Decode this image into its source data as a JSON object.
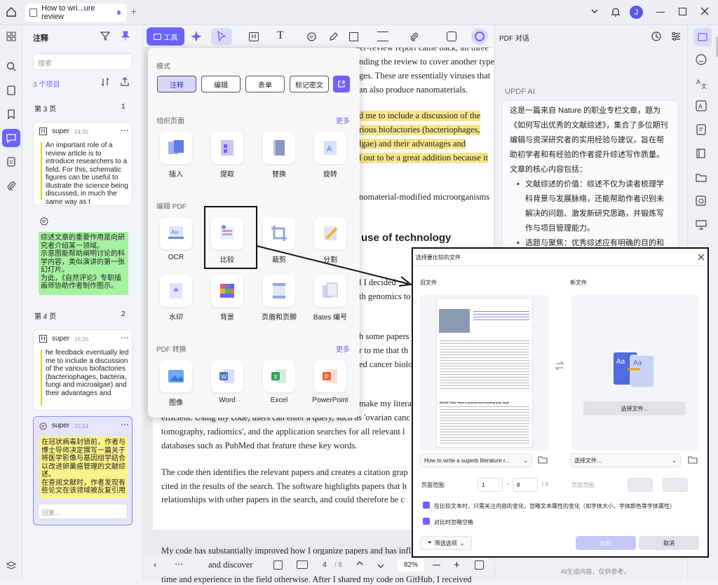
{
  "tab": {
    "title": "How to wri...ure review",
    "add": "+"
  },
  "window": {
    "avatar_initial": "J"
  },
  "comments_panel": {
    "title": "注释",
    "search_placeholder": "搜索",
    "count": "3 个项目",
    "page3": "第 3 页",
    "page3_count": "1",
    "page4": "第 4 页",
    "page4_count": "2",
    "cards": [
      {
        "user": "super",
        "time": "14:35",
        "text": "An important role of a review article is to introduce researchers to a field. For this, schematic figures can be useful to illustrate the science being discussed, in much the same way as t"
      },
      {
        "text": "综述文章的重要作用是向研究者介绍某一领域。\n示意图能帮助阐明讨论的科学内容，类似演讲的第一张幻灯片。\n为此，《自然评论》专职插画师协助作者制作图示。"
      },
      {
        "user": "super",
        "time": "15:20",
        "text": "he feedback eventually led me to include a discussion of the various biofactories (bacteriophages, bacteria, fungi and microalgae) and their advantages and"
      },
      {
        "user": "super",
        "time": "15:24",
        "text": "在冠状病毒封锁前，作者与博士导师决定撰写一篇关于将医学影像与基因组学结合以改进卵巢癌管理的文献综述。\n在查阅文献时，作者发现有些论文在该领域被反复引用"
      }
    ],
    "reply_placeholder": "回复..."
  },
  "toolbar": {
    "tools_label": "工具",
    "zoom": "82%",
    "page_current": "4",
    "page_total": "/ 8"
  },
  "tools_menu": {
    "mode_title": "模式",
    "modes": [
      "注释",
      "编辑",
      "表单",
      "标记密文"
    ],
    "organize_title": "组织页面",
    "more": "更多",
    "organize": [
      "插入",
      "提取",
      "替换",
      "旋转"
    ],
    "edit_title": "编辑 PDF",
    "edit": [
      "OCR",
      "比较",
      "裁剪",
      "分割",
      "水印",
      "背景",
      "页眉和页脚",
      "Bates 编号"
    ],
    "convert_title": "PDF 转换",
    "convert": [
      "图像",
      "Word",
      "Excel",
      "PowerPoint"
    ]
  },
  "document": {
    "lines": [
      "However, when the first peer-review report came back, all three",
      "nding the review to cover another type",
      "ges. These are essentially viruses that",
      "an also produce nanomaterials.",
      "d me to include a discussion of the",
      "rious biofactories (bacteriophages,",
      "lgae) and their advantages and",
      "l out to be a great addition because it",
      "nomaterial-modified microorganisms",
      "use of technology",
      "l I decided",
      "th genomics to",
      "h some papers",
      "r to me that th",
      "ed cancer biolo",
      "make my literat",
      "efficient. Using my code, users can enter a query, such as 'ovarian canc",
      "tomography, radiomics', and the application searches for all relevant l",
      "databases such as PubMed that feature these key words.",
      "The code then identifies the relevant papers and creates a citation grap",
      "cited in the results of the search. The software highlights papers that h",
      "relationships with other papers in the search, and could therefore be c",
      "My code has substantially improved how I organize papers and has infl",
      "and discover",
      "time and experience in the field otherwise. After I shared my code on GitHub, I received"
    ]
  },
  "chat_panel": {
    "title": "PDF 对话",
    "ai_label": "UPDF AI",
    "intro": "这是一篇来自 Nature 的职业专栏文章，题为《如何写出优秀的文献综述》，集合了多位期刊编辑与资深研究者的实用经验与建议，旨在帮助初学者和有经验的作者提升综述写作质量。文章的核心内容包括：",
    "bullets": [
      "文献综述的价值：综述不仅为读者梳理学科背景与发展脉络，还能帮助作者识别未解决的问题、激发新研究思路，并锻炼写作与项目管理能力。",
      "选题与聚焦：优秀综述应有明确的目的和"
    ],
    "footer": "AI生成内容，仅供参考。"
  },
  "compare_dialog": {
    "title": "选择要比较的文件",
    "old_label": "旧文件",
    "new_label": "新文件",
    "choose_button": "选择文件...",
    "old_file": "How to write a superb literature r...",
    "new_file": "选择文件...",
    "page_range_label": "页面范围:",
    "old_from": "1",
    "old_to": "8",
    "old_total": "/ 8",
    "new_page_range_label": "页面范围:",
    "option1": "在比较文本时，只需关注内容的变化，忽略文本属性的变化（如字体大小、字体颜色等字体属性）",
    "option2": "对比时忽略空格",
    "filter_button": "筛选选项",
    "compare_button": "比较",
    "cancel_button": "取消",
    "thumb_heading": "BOZHI TIAN: Have a process and develop your style"
  }
}
